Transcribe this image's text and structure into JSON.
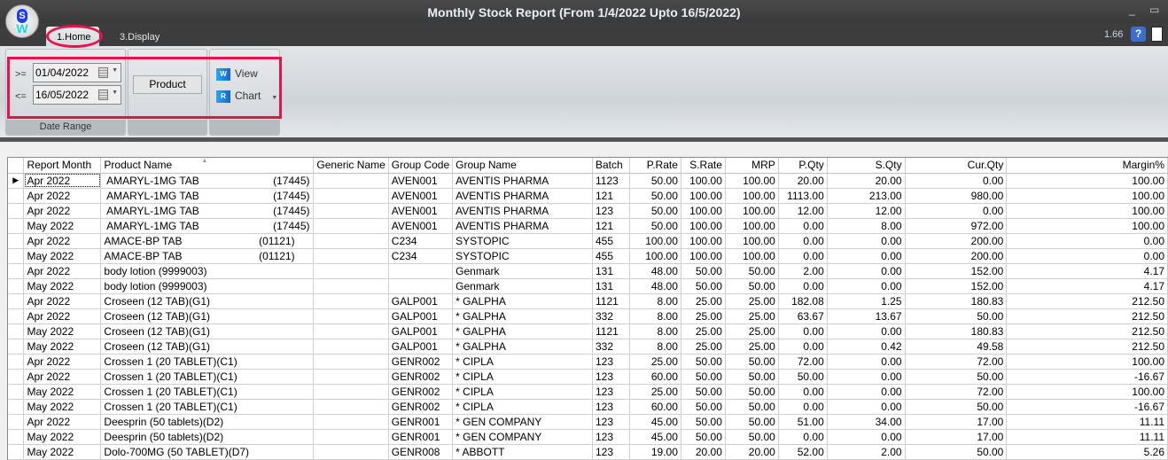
{
  "window": {
    "title": "Monthly Stock Report (From 1/4/2022 Upto 16/5/2022)",
    "minimize": "_",
    "maximize": "▭",
    "version": "1.66",
    "help_icon": "?"
  },
  "logo": {
    "letter_top": "S",
    "letter_bottom": "W"
  },
  "tabs": [
    {
      "label": "1.Home",
      "active": true
    },
    {
      "label": "3.Display",
      "active": false
    }
  ],
  "ribbon": {
    "date_range": {
      "label": "Date Range",
      "from_op": ">=",
      "from": "01/04/2022",
      "to_op": "<=",
      "to": "16/05/2022"
    },
    "product_button": "Product",
    "view_button": "View",
    "chart_button": "Chart",
    "view_icon": "W",
    "chart_icon": "R"
  },
  "highlight_color": "#e8124a",
  "table": {
    "columns": [
      "Report Month",
      "Product Name",
      "Generic Name",
      "Group Code",
      "Group Name",
      "Batch",
      "P.Rate",
      "S.Rate",
      "MRP",
      "P.Qty",
      "S.Qty",
      "Cur.Qty",
      "Margin%"
    ],
    "rows": [
      [
        "Apr 2022",
        " AMARYL-1MG TAB                         (17445)",
        "",
        "AVEN001",
        "AVENTIS PHARMA",
        "1123",
        "50.00",
        "100.00",
        "100.00",
        "20.00",
        "20.00",
        "0.00",
        "100.00"
      ],
      [
        "Apr 2022",
        " AMARYL-1MG TAB                         (17445)",
        "",
        "AVEN001",
        "AVENTIS PHARMA",
        "121",
        "50.00",
        "100.00",
        "100.00",
        "1113.00",
        "213.00",
        "980.00",
        "100.00"
      ],
      [
        "Apr 2022",
        " AMARYL-1MG TAB                         (17445)",
        "",
        "AVEN001",
        "AVENTIS PHARMA",
        "123",
        "50.00",
        "100.00",
        "100.00",
        "12.00",
        "12.00",
        "0.00",
        "100.00"
      ],
      [
        "May 2022",
        " AMARYL-1MG TAB                         (17445)",
        "",
        "AVEN001",
        "AVENTIS PHARMA",
        "121",
        "50.00",
        "100.00",
        "100.00",
        "0.00",
        "8.00",
        "972.00",
        "100.00"
      ],
      [
        "Apr 2022",
        "AMACE-BP TAB                          (01121)",
        "",
        "C234",
        "SYSTOPIC",
        "455",
        "100.00",
        "100.00",
        "100.00",
        "0.00",
        "0.00",
        "200.00",
        "0.00"
      ],
      [
        "May 2022",
        "AMACE-BP TAB                          (01121)",
        "",
        "C234",
        "SYSTOPIC",
        "455",
        "100.00",
        "100.00",
        "100.00",
        "0.00",
        "0.00",
        "200.00",
        "0.00"
      ],
      [
        "Apr 2022",
        "body lotion (9999003)",
        "",
        "",
        "Genmark",
        "131",
        "48.00",
        "50.00",
        "50.00",
        "2.00",
        "0.00",
        "152.00",
        "4.17"
      ],
      [
        "May 2022",
        "body lotion (9999003)",
        "",
        "",
        "Genmark",
        "131",
        "48.00",
        "50.00",
        "50.00",
        "0.00",
        "0.00",
        "152.00",
        "4.17"
      ],
      [
        "Apr 2022",
        "Croseen (12 TAB)(G1)",
        "",
        "GALP001",
        "* GALPHA",
        "1121",
        "8.00",
        "25.00",
        "25.00",
        "182.08",
        "1.25",
        "180.83",
        "212.50"
      ],
      [
        "Apr 2022",
        "Croseen (12 TAB)(G1)",
        "",
        "GALP001",
        "* GALPHA",
        "332",
        "8.00",
        "25.00",
        "25.00",
        "63.67",
        "13.67",
        "50.00",
        "212.50"
      ],
      [
        "May 2022",
        "Croseen (12 TAB)(G1)",
        "",
        "GALP001",
        "* GALPHA",
        "1121",
        "8.00",
        "25.00",
        "25.00",
        "0.00",
        "0.00",
        "180.83",
        "212.50"
      ],
      [
        "May 2022",
        "Croseen (12 TAB)(G1)",
        "",
        "GALP001",
        "* GALPHA",
        "332",
        "8.00",
        "25.00",
        "25.00",
        "0.00",
        "0.42",
        "49.58",
        "212.50"
      ],
      [
        "Apr 2022",
        "Crossen 1 (20 TABLET)(C1)",
        "",
        "GENR002",
        "* CIPLA",
        "123",
        "25.00",
        "50.00",
        "50.00",
        "72.00",
        "0.00",
        "72.00",
        "100.00"
      ],
      [
        "Apr 2022",
        "Crossen 1 (20 TABLET)(C1)",
        "",
        "GENR002",
        "* CIPLA",
        "123",
        "60.00",
        "50.00",
        "50.00",
        "50.00",
        "0.00",
        "50.00",
        "-16.67"
      ],
      [
        "May 2022",
        "Crossen 1 (20 TABLET)(C1)",
        "",
        "GENR002",
        "* CIPLA",
        "123",
        "25.00",
        "50.00",
        "50.00",
        "0.00",
        "0.00",
        "72.00",
        "100.00"
      ],
      [
        "May 2022",
        "Crossen 1 (20 TABLET)(C1)",
        "",
        "GENR002",
        "* CIPLA",
        "123",
        "60.00",
        "50.00",
        "50.00",
        "0.00",
        "0.00",
        "50.00",
        "-16.67"
      ],
      [
        "Apr 2022",
        "Deesprin (50 tablets)(D2)",
        "",
        "GENR001",
        "* GEN COMPANY",
        "123",
        "45.00",
        "50.00",
        "50.00",
        "51.00",
        "34.00",
        "17.00",
        "11.11"
      ],
      [
        "May 2022",
        "Deesprin (50 tablets)(D2)",
        "",
        "GENR001",
        "* GEN COMPANY",
        "123",
        "45.00",
        "50.00",
        "50.00",
        "0.00",
        "0.00",
        "17.00",
        "11.11"
      ],
      [
        "May 2022",
        "Dolo-700MG (50 TABLET)(D7)",
        "",
        "GENR008",
        "* ABBOTT",
        "123",
        "19.00",
        "20.00",
        "20.00",
        "52.00",
        "2.00",
        "50.00",
        "5.26"
      ]
    ]
  }
}
